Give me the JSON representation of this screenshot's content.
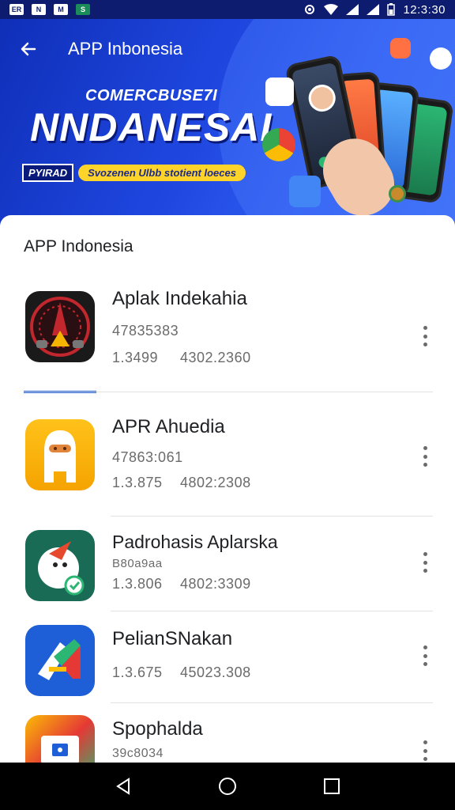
{
  "status_bar": {
    "left_icons": [
      "ER",
      "N",
      "M",
      "S"
    ],
    "time": "12:3:30"
  },
  "header": {
    "back_icon": "arrow-left-icon",
    "title": "APP Inbonesia",
    "banner": {
      "subtitle": "COMERCBUSE7I",
      "title": "NNDANESAI",
      "tag_left": "PYIRAD",
      "tag_right": "Svozenen Ulbb stotient loeces"
    }
  },
  "section": {
    "title": "APP Indonesia"
  },
  "apps": [
    {
      "name": "Aplak Indekahia",
      "meta1": "47835383",
      "meta2a": "1.3499",
      "meta2b": "4302.2360",
      "icon": "speedometer-app-icon"
    },
    {
      "name": "APR Ahuedia",
      "meta1": "47863:061",
      "meta2a": "1.3.875",
      "meta2b": "4802:2308",
      "icon": "ninja-app-icon"
    },
    {
      "name": "Padrohasis Aplarska",
      "meta1": "B80a9aa",
      "meta2a": "1.3.806",
      "meta2b": "4802:3309",
      "icon": "bird-app-icon"
    },
    {
      "name": "PelianSNakan",
      "meta1": "",
      "meta2a": "1.3.675",
      "meta2b": "45023.308",
      "icon": "maps-app-icon"
    },
    {
      "name": "Spophalda",
      "meta1": "39c8034",
      "meta2a": "",
      "meta2b": "",
      "icon": "slides-app-icon"
    }
  ],
  "colors": {
    "header_blue": "#1f47e0",
    "accent": "#1e5fd8",
    "banner_yellow": "#ffd42a"
  },
  "nav": {
    "back_icon": "triangle-back-icon",
    "home_icon": "circle-home-icon",
    "recents_icon": "square-recents-icon"
  }
}
